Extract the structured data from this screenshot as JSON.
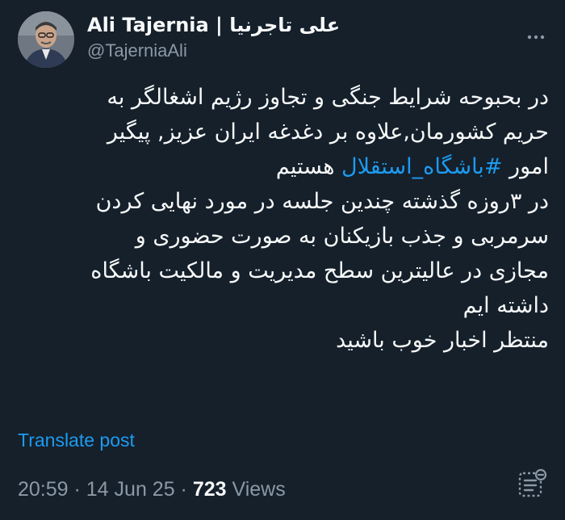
{
  "author": {
    "display_name": "Ali Tajernia | علی تاجرنیا",
    "handle": "@TajerniaAli",
    "avatar_icon": "profile-photo"
  },
  "tweet": {
    "lines": [
      {
        "text": "در بحبوحه شرایط جنگی و تجاوز رژیم اشغالگر به"
      },
      {
        "text": "حریم کشورمان,علاوه بر دغدغه ایران عزیز, پیگیر"
      },
      {
        "prefix": "امور ",
        "hashtag": "#باشگاه_استقلال",
        "suffix": " هستیم"
      },
      {
        "text": "در ۳روزه گذشته چندین جلسه در مورد نهایی کردن"
      },
      {
        "text": "سرمربی و جذب بازیکنان به صورت حضوری و"
      },
      {
        "text": "مجازی در عالیترین سطح مدیریت و مالکیت باشگاه"
      },
      {
        "text": "داشته ایم"
      },
      {
        "text": "منتظر اخبار خوب باشید"
      }
    ]
  },
  "translate_label": "Translate post",
  "meta": {
    "time": "20:59",
    "separator": " · ",
    "date": "14 Jun 25",
    "views_count": "723",
    "views_label": " Views"
  },
  "icons": {
    "more": "more-horizontal-icon",
    "edit_history": "edit-history-icon"
  },
  "colors": {
    "background": "#15202b",
    "text": "#f7f9f9",
    "secondary": "#8b98a5",
    "accent": "#1d9bf0"
  }
}
